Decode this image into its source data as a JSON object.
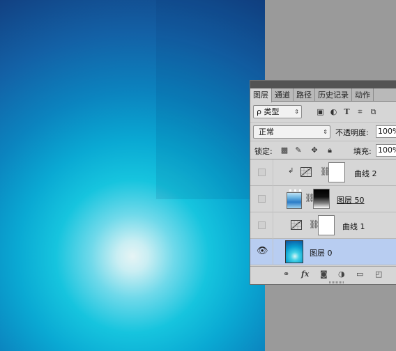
{
  "canvas": {
    "colors": {
      "center": "#e6f4f5",
      "mid": "#16c4de",
      "edge": "#0f2f6a"
    }
  },
  "panel": {
    "tabs": [
      {
        "label": "图层",
        "active": true
      },
      {
        "label": "通道",
        "active": false
      },
      {
        "label": "路径",
        "active": false
      },
      {
        "label": "历史记录",
        "active": false
      },
      {
        "label": "动作",
        "active": false
      }
    ],
    "filter": {
      "label": "ρ 类型",
      "icons": [
        "image-filter-icon",
        "adjustment-filter-icon",
        "type-filter-icon",
        "shape-filter-icon",
        "smart-object-filter-icon"
      ]
    },
    "blend_mode": "正常",
    "opacity_label": "不透明度:",
    "opacity_value": "100%",
    "lock_label": "锁定:",
    "fill_label": "填充:",
    "fill_value": "100%",
    "layers": [
      {
        "name": "曲线 2",
        "visible": false,
        "clipped": true,
        "type": "curves-adjustment"
      },
      {
        "name": "图层 50",
        "visible": false,
        "clipped": false,
        "type": "pixel-with-mask"
      },
      {
        "name": "曲线 1",
        "visible": false,
        "clipped": false,
        "type": "curves-adjustment"
      },
      {
        "name": "图层 0",
        "visible": true,
        "clipped": false,
        "type": "pixel",
        "selected": true
      }
    ],
    "footer_icons": [
      "link-icon",
      "fx-icon",
      "add-mask-icon",
      "new-adjustment-icon",
      "new-group-icon",
      "new-layer-icon"
    ],
    "fx_label": "fx",
    "colors": {
      "panel": "#d6d6d6",
      "selected": "#b8cdf1",
      "tabbar": "#b9b9b9"
    }
  }
}
